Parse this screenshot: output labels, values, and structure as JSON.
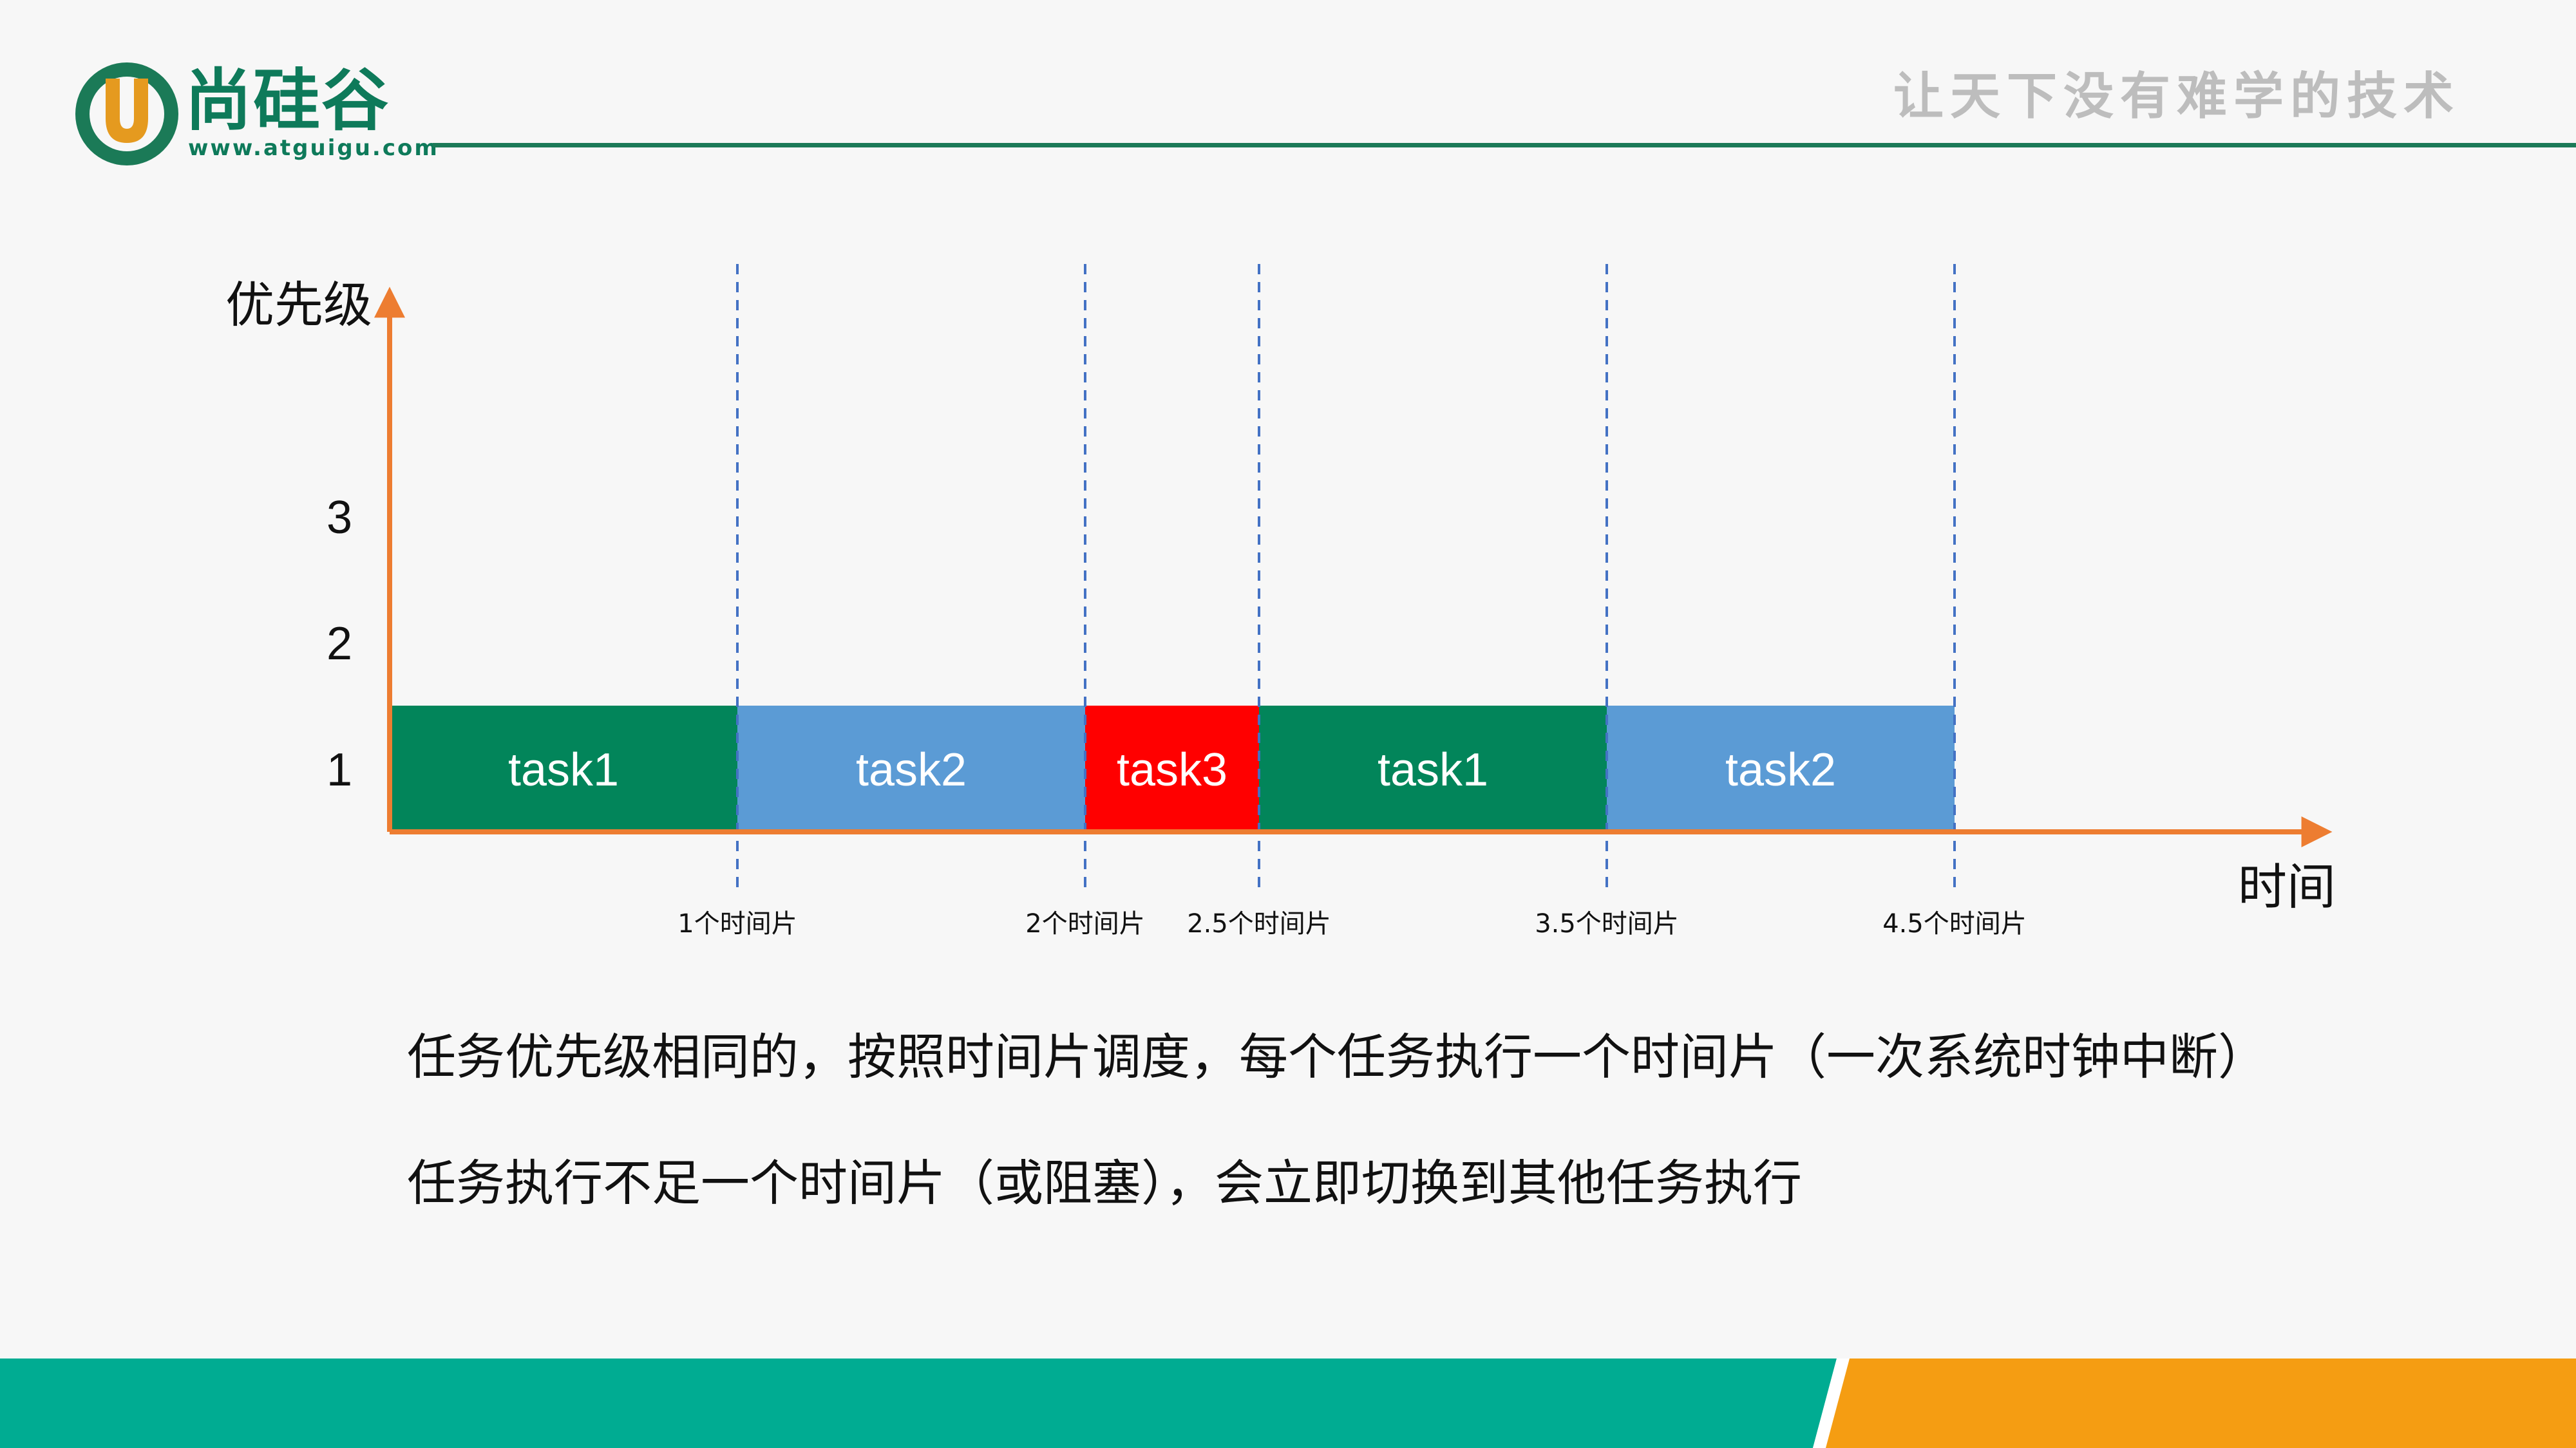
{
  "header": {
    "brand_name": "尚硅谷",
    "brand_url": "www.atguigu.com",
    "slogan": "让天下没有难学的技术"
  },
  "diagram": {
    "y_axis_label": "优先级",
    "x_axis_label": "时间",
    "priority_levels": [
      "1",
      "2",
      "3"
    ],
    "time_markers": [
      {
        "t": 1,
        "label": "1个时间片"
      },
      {
        "t": 2,
        "label": "2个时间片"
      },
      {
        "t": 2.5,
        "label": "2.5个时间片"
      },
      {
        "t": 3.5,
        "label": "3.5个时间片"
      },
      {
        "t": 4.5,
        "label": "4.5个时间片"
      }
    ],
    "tasks": [
      {
        "name": "task1",
        "start": 0,
        "end": 1,
        "priority": 1,
        "color": "#02855a"
      },
      {
        "name": "task2",
        "start": 1,
        "end": 2,
        "priority": 1,
        "color": "#5b9bd5"
      },
      {
        "name": "task3",
        "start": 2,
        "end": 2.5,
        "priority": 1,
        "color": "#ff0000"
      },
      {
        "name": "task1",
        "start": 2.5,
        "end": 3.5,
        "priority": 1,
        "color": "#02855a"
      },
      {
        "name": "task2",
        "start": 3.5,
        "end": 4.5,
        "priority": 1,
        "color": "#5b9bd5"
      }
    ],
    "axis_color": "#ed7d31",
    "marker_color": "#4472c4"
  },
  "captions": [
    "任务优先级相同的，按照时间片调度，每个任务执行一个时间片（一次系统时钟中断）",
    "任务执行不足一个时间片（或阻塞），会立即切换到其他任务执行"
  ],
  "footer": {
    "left_color": "#00ac92",
    "right_color": "#f59d12"
  }
}
